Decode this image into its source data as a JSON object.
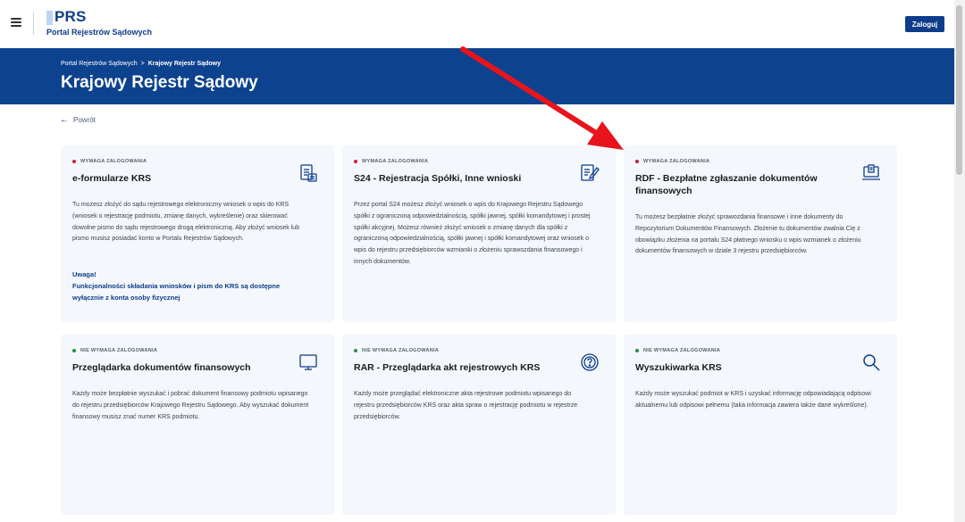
{
  "header": {
    "logo_main": "PRS",
    "logo_sub": "Portal Rejestrów Sądowych",
    "login_label": "Zaloguj",
    "menu_icon": "hamburger-menu-icon"
  },
  "banner": {
    "breadcrumb": [
      "Portal Rejestrów Sądowych",
      ">",
      "Krajowy Rejestr Sądowy"
    ],
    "title": "Krajowy Rejestr Sądowy",
    "color": "#0d428f"
  },
  "back_label": "Powrót",
  "cards": [
    {
      "badge": "WYMAGA ZALOGOWANIA",
      "badge_color": "#d0202f",
      "title": "e-formularze KRS",
      "icon": "form-document-icon",
      "description": "Tu możesz złożyć do sądu rejestrowego elektroniczny wniosek o wpis do KRS (wniosek o rejestrację podmiotu, zmianę danych, wykreślenie) oraz skierować dowolne pismo do sądu rejestrowego drogą elektroniczną. Aby złożyć wniosek lub pismo musisz posiadać konto w Portalu Rejestrów Sądowych.",
      "note_heading": "Uwaga!",
      "note_text": "Funkcjonalności składania wniosków i pism do KRS są dostępne wyłącznie z konta osoby fizycznej"
    },
    {
      "badge": "WYMAGA ZALOGOWANIA",
      "badge_color": "#d0202f",
      "title": "S24 - Rejestracja Spółki, Inne wnioski",
      "icon": "document-edit-icon",
      "description": "Przez portal S24 możesz złożyć wniosek o wpis do Krajowego Rejestru Sądowego spółki z ograniczoną odpowiedzialnością, spółki jawnej, spółki komandytowej i prostej spółki akcyjnej. Możesz również złożyć wniosek o zmianę danych dla spółki z ograniczoną odpowiedzialnością, spółki jawnej i spółki komandytowej oraz wniosek o wpis do rejestru przedsiębiorców wzmianki o złożeniu sprawozdania finansowego i innych dokumentów."
    },
    {
      "badge": "WYMAGA ZALOGOWANIA",
      "badge_color": "#d0202f",
      "title": "RDF - Bezpłatne zgłaszanie dokumentów finansowych",
      "icon": "laptop-document-icon",
      "description": "Tu możesz bezpłatnie złożyć sprawozdania finansowe i inne dokumenty do Repozytorium Dokumentów Finansowych. Złożenie tu dokumentów zwalnia Cię z obowiązku złożenia na portalu S24 płatnego wniosku o wpis wzmianek o złożeniu dokumentów finansowych w dziale 3 rejestru przedsiębiorców."
    },
    {
      "badge": "NIE WYMAGA ZALOGOWANIA",
      "badge_color": "#2e8b3c",
      "title": "Przeglądarka dokumentów finansowych",
      "icon": "monitor-icon",
      "description": "Każdy może bezpłatnie wyszukać i pobrać dokument finansowy podmiotu wpisanego do rejestru przedsiębiorców Krajowego Rejestru Sądowego. Aby wyszukać dokument finansowy musisz znać numer KRS podmiotu."
    },
    {
      "badge": "NIE WYMAGA ZALOGOWANIA",
      "badge_color": "#2e8b3c",
      "title": "RAR - Przeglądarka akt rejestrowych KRS",
      "icon": "question-circle-icon",
      "description": "Każdy może przeglądać elektroniczne akta rejestrowe podmiotu wpisanego do rejestru przedsiębiorców KRS oraz akta spraw o rejestrację podmiotu w rejestrze przedsiębiorców."
    },
    {
      "badge": "NIE WYMAGA ZALOGOWANIA",
      "badge_color": "#2e8b3c",
      "title": "Wyszukiwarka KRS",
      "icon": "search-icon",
      "description": "Każdy może wyszukać podmiot w KRS i uzyskać informację odpowiadającą odpisowi aktualnemu lub odpisowi pełnemu (taka informacja zawiera także dane wykreślone)."
    }
  ],
  "annotation": {
    "type": "red-arrow",
    "color": "#e8141c"
  }
}
